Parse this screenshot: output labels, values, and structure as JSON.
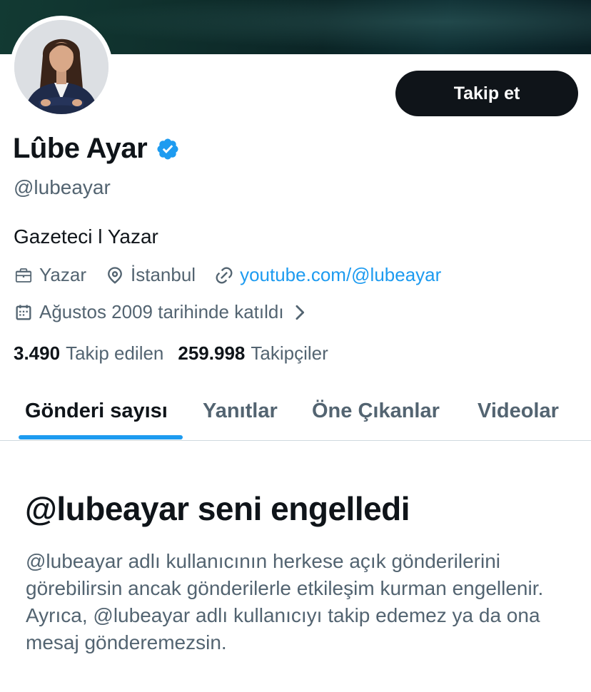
{
  "profile": {
    "display_name": "Lûbe Ayar",
    "verified_icon": "verified-badge-icon",
    "handle": "@lubeayar",
    "bio": "Gazeteci l Yazar",
    "occupation": "Yazar",
    "location": "İstanbul",
    "website": "youtube.com/@lubeayar",
    "joined": "Ağustos 2009 tarihinde katıldı"
  },
  "actions": {
    "follow_label": "Takip et"
  },
  "stats": {
    "following_count": "3.490",
    "following_label": "Takip edilen",
    "followers_count": "259.998",
    "followers_label": "Takipçiler"
  },
  "tabs": [
    {
      "label": "Gönderi sayısı",
      "active": true
    },
    {
      "label": "Yanıtlar",
      "active": false
    },
    {
      "label": "Öne Çıkanlar",
      "active": false
    },
    {
      "label": "Videolar",
      "active": false
    }
  ],
  "blocked": {
    "title": "@lubeayar seni engelledi",
    "description": "@lubeayar adlı kullanıcının herkese açık gönderilerini görebilirsin ancak gönderilerle etkileşim kurman engellenir. Ayrıca, @lubeayar adlı kullanıcıyı takip edemez ya da ona mesaj gönderemezsin."
  },
  "colors": {
    "accent": "#1d9bf0",
    "text_primary": "#0f1419",
    "text_secondary": "#536471",
    "button_bg": "#0f1419"
  }
}
